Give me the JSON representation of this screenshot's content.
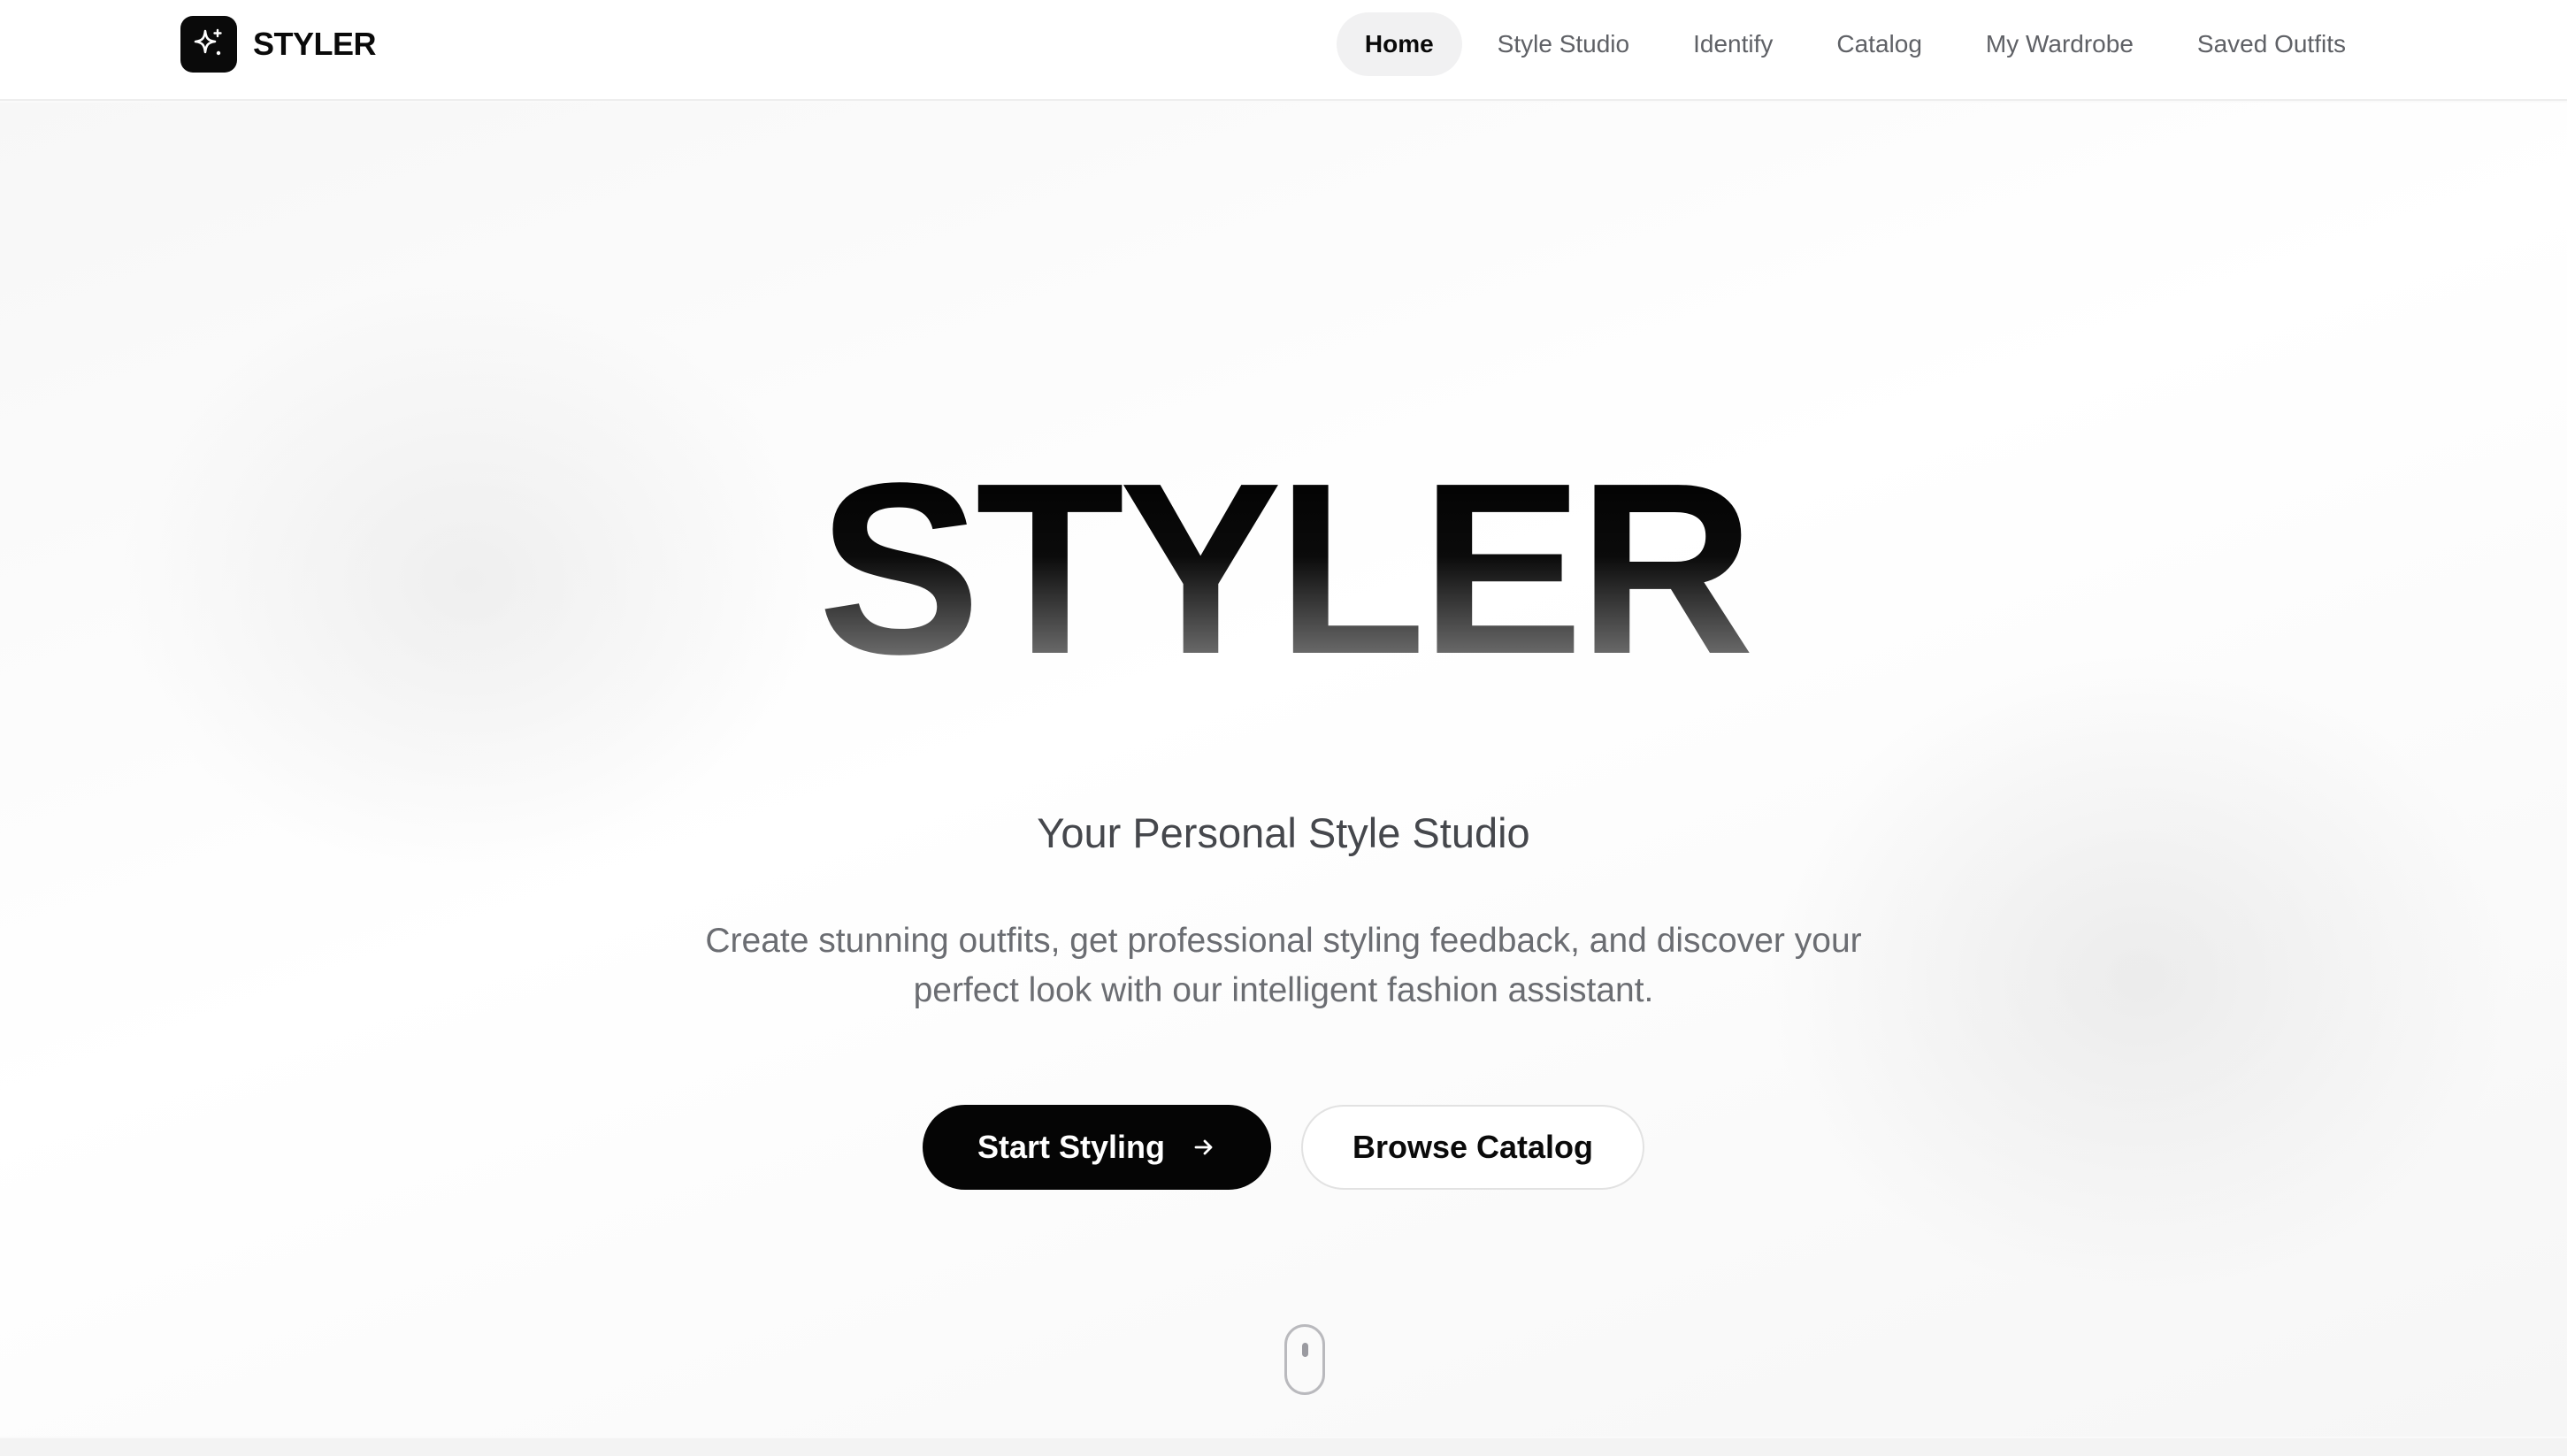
{
  "header": {
    "brand_name": "STYLER",
    "logo_icon": "sparkles-icon",
    "nav": [
      {
        "label": "Home",
        "active": true
      },
      {
        "label": "Style Studio",
        "active": false
      },
      {
        "label": "Identify",
        "active": false
      },
      {
        "label": "Catalog",
        "active": false
      },
      {
        "label": "My Wardrobe",
        "active": false
      },
      {
        "label": "Saved Outfits",
        "active": false
      }
    ]
  },
  "hero": {
    "title": "STYLER",
    "subtitle": "Your Personal Style Studio",
    "description": "Create stunning outfits, get professional styling feedback, and discover your perfect look with our intelligent fashion assistant.",
    "primary_cta": "Start Styling",
    "primary_cta_icon": "arrow-right-icon",
    "secondary_cta": "Browse Catalog",
    "scroll_icon": "mouse-scroll-icon"
  },
  "colors": {
    "primary": "#050505",
    "nav_active_bg": "#f1f1f2",
    "text_muted": "#6b6d72"
  }
}
